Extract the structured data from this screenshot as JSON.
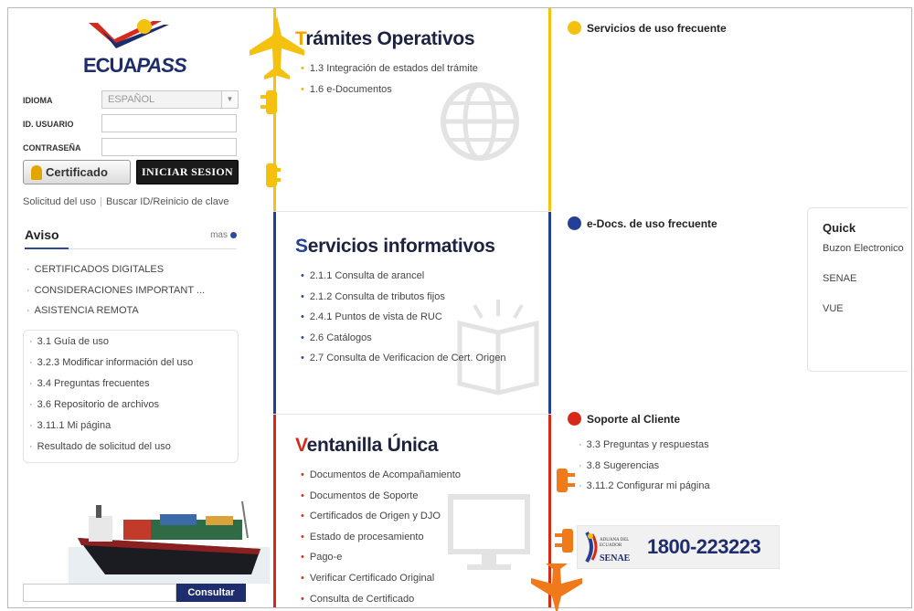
{
  "brand": {
    "logo_text_a": "ECUA",
    "logo_text_b": "PASS"
  },
  "login": {
    "idioma_label": "IDIOMA",
    "idioma_value": "ESPAÑOL",
    "usuario_label": "ID. USUARIO",
    "usuario_value": "",
    "password_label": "CONTRASEÑA",
    "password_value": "",
    "cert_button": "Certificado",
    "login_button": "INICIAR SESION",
    "link_solicitud": "Solicitud del uso",
    "link_buscar": "Buscar ID/Reinicio de clave"
  },
  "aviso": {
    "title": "Aviso",
    "more": "mas",
    "items": [
      "CERTIFICADOS DIGITALES",
      "CONSIDERACIONES IMPORTANT ...",
      "ASISTENCIA REMOTA"
    ]
  },
  "guia": {
    "items": [
      "3.1 Guía de uso",
      "3.2.3 Modificar información del uso",
      "3.4 Preguntas frecuentes",
      "3.6 Repositorio de archivos",
      "3.11.1 Mi página",
      "Resultado de solicitud del uso"
    ]
  },
  "consult": {
    "input_value": "",
    "button": "Consultar"
  },
  "tramites": {
    "title_first": "T",
    "title_rest": "rámites Operativos",
    "items": [
      "1.3 Integración de estados del trámite",
      "1.6 e-Documentos"
    ]
  },
  "servicios": {
    "title_first": "S",
    "title_rest": "ervicios informativos",
    "items": [
      "2.1.1 Consulta de arancel",
      "2.1.2 Consulta de tributos fijos",
      "2.4.1 Puntos de vista de RUC",
      "2.6 Catálogos",
      "2.7 Consulta de Verificacion de Cert. Origen"
    ]
  },
  "ventanilla": {
    "title_first": "V",
    "title_rest": "entanilla Única",
    "items": [
      "Documentos de Acompañamiento",
      "Documentos de Soporte",
      "Certificados de Origen y DJO",
      "Estado de procesamiento",
      "Pago-e",
      "Verificar Certificado Original",
      "Consulta de Certificado"
    ]
  },
  "right": {
    "servicios_frecuentes": "Servicios de uso frecuente",
    "edocs_frecuentes": "e-Docs. de uso frecuente",
    "soporte": "Soporte al Cliente",
    "soporte_items": [
      "3.3 Preguntas y respuestas",
      "3.8 Sugerencias",
      "3.11.2 Configurar mi página"
    ],
    "hotline_small_1": "ADUANA DEL",
    "hotline_small_2": "ECUADOR",
    "hotline_brand": "SENAE",
    "hotline_number": "1800-223223"
  },
  "quick": {
    "title": "Quick",
    "items": [
      "Buzon Electronico",
      "SENAE",
      "VUE"
    ]
  },
  "colors": {
    "yellow": "#f4c10f",
    "blue": "#233f96",
    "red": "#d42a17",
    "navy": "#1e2d6e",
    "orange": "#f07a1a"
  },
  "icons": [
    "shield-icon",
    "globe-icon",
    "airplane-icon",
    "book-icon",
    "monitor-icon",
    "ship-image",
    "plug-icon"
  ]
}
